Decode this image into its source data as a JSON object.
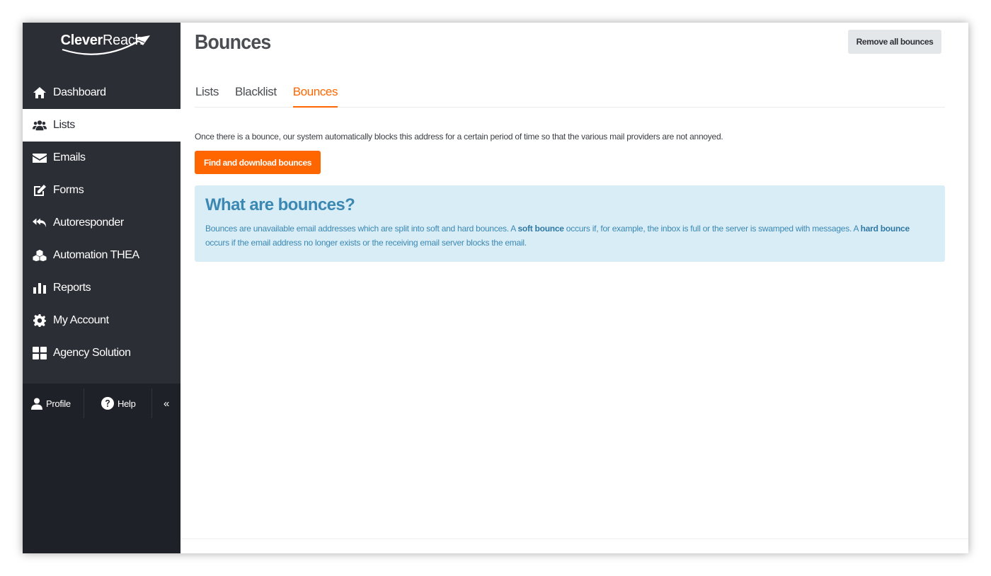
{
  "brand": {
    "logo_bold": "Clever",
    "logo_light": "Reach"
  },
  "colors": {
    "sidebar_bg": "#2b2e35",
    "accent": "#ff6600",
    "info_bg": "#d9edf6",
    "info_text": "#3b88b3"
  },
  "sidebar": {
    "items": [
      {
        "label": "Dashboard",
        "icon": "home-icon"
      },
      {
        "label": "Lists",
        "icon": "users-icon",
        "active": true
      },
      {
        "label": "Emails",
        "icon": "envelope-icon"
      },
      {
        "label": "Forms",
        "icon": "edit-icon"
      },
      {
        "label": "Autoresponder",
        "icon": "reply-all-icon"
      },
      {
        "label": "Automation THEA",
        "icon": "cubes-icon"
      },
      {
        "label": "Reports",
        "icon": "bar-chart-icon"
      },
      {
        "label": "My Account",
        "icon": "gear-icon"
      },
      {
        "label": "Agency Solution",
        "icon": "grid-icon"
      }
    ],
    "bottom": {
      "profile_label": "Profile",
      "help_label": "Help",
      "collapse_label": "«"
    }
  },
  "header": {
    "title": "Bounces",
    "remove_all_label": "Remove all bounces"
  },
  "tabs": [
    {
      "label": "Lists",
      "active": false
    },
    {
      "label": "Blacklist",
      "active": false
    },
    {
      "label": "Bounces",
      "active": true
    }
  ],
  "main": {
    "intro": "Once there is a bounce, our system automatically blocks this address for a certain period of time so that the various mail providers are not annoyed.",
    "find_button_label": "Find and download bounces"
  },
  "info": {
    "title": "What are bounces?",
    "text_1": "Bounces are unavailable email addresses which are split into soft and hard bounces. A ",
    "bold_1": "soft bounce",
    "text_2": " occurs if, for example, the inbox is full or the server is swamped with messages. A ",
    "bold_2": "hard bounce",
    "text_3": " occurs if the email address no longer exists or the receiving email server blocks the email."
  }
}
